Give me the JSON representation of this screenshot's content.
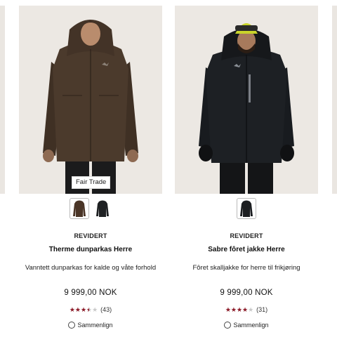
{
  "products": [
    {
      "tag": "Fair Trade",
      "badge": "REVIDERT",
      "name": "Therme dunparkas Herre",
      "description": "Vanntett dunparkas for kalde og våte forhold",
      "price": "9 999,00 NOK",
      "rating": 3.5,
      "rating_max": 5,
      "review_count": "(43)",
      "compare_label": "Sammenlign",
      "swatch_colors": [
        "#4a3527",
        "#1f2123"
      ],
      "jacket_color": "#4b3a2c",
      "accent_color": ""
    },
    {
      "tag": "",
      "badge": "REVIDERT",
      "name": "Sabre fôret jakke Herre",
      "description": "Fôret skalljakke for herre til frikjøring",
      "price": "9 999,00 NOK",
      "rating": 4,
      "rating_max": 5,
      "review_count": "(31)",
      "compare_label": "Sammenlign",
      "swatch_colors": [
        "#1c1e21"
      ],
      "jacket_color": "#1d2024",
      "accent_color": "#c9d42a"
    }
  ],
  "colors": {
    "star_fill": "#8e1a28",
    "image_bg": "#ece8e3"
  },
  "icons": {
    "star": "star-icon",
    "compare": "circle-checkbox-icon",
    "logo": "bird-logo-icon"
  }
}
